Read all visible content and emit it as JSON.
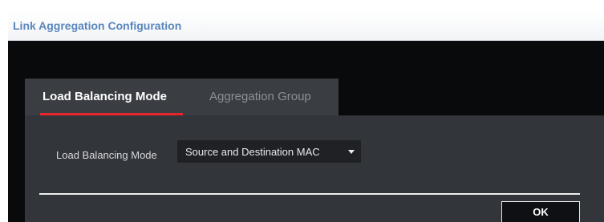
{
  "dialog": {
    "title": "Link Aggregation Configuration"
  },
  "tabs": [
    {
      "label": "Load Balancing Mode",
      "active": true
    },
    {
      "label": "Aggregation Group",
      "active": false
    }
  ],
  "form": {
    "load_balancing_mode": {
      "label": "Load Balancing Mode",
      "selected": "Source and Destination MAC"
    }
  },
  "buttons": {
    "ok_label": "OK"
  },
  "colors": {
    "accent_red": "#e8242e",
    "title_blue": "#5a86bd",
    "panel_bg": "#32353a",
    "tabbar_bg": "#3a3d42",
    "dialog_bg": "#090a0c"
  }
}
